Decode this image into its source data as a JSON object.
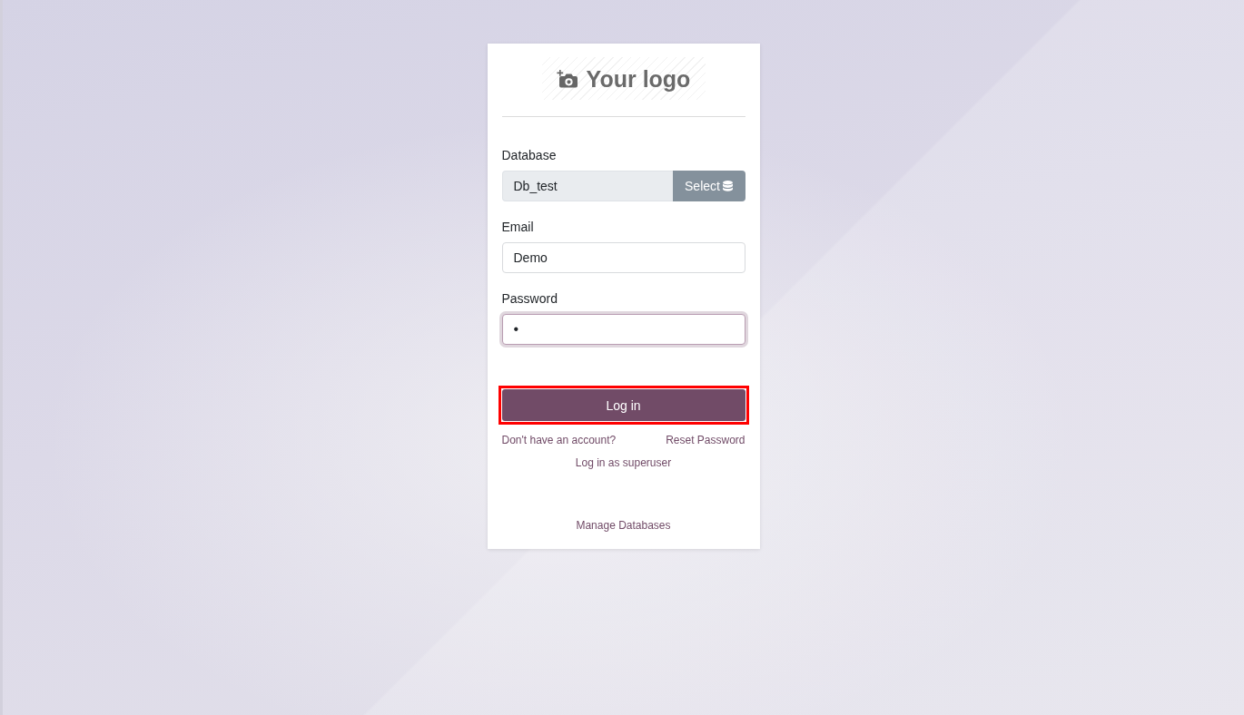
{
  "logo": {
    "text": "Your logo"
  },
  "fields": [
    {
      "kind": "select",
      "label": "Database",
      "value": "Db_test",
      "button": "Select",
      "focused": false
    },
    {
      "kind": "text",
      "label": "Email",
      "value": "Demo",
      "focused": false
    },
    {
      "kind": "password",
      "label": "Password",
      "value": "•",
      "focused": true
    }
  ],
  "login_button": {
    "label": "Log in",
    "highlighted": true
  },
  "signup_link": "Don't have an account?",
  "reset_link": "Reset Password",
  "superuser_link": "Log in as superuser",
  "manage_databases_link": "Manage Databases"
}
